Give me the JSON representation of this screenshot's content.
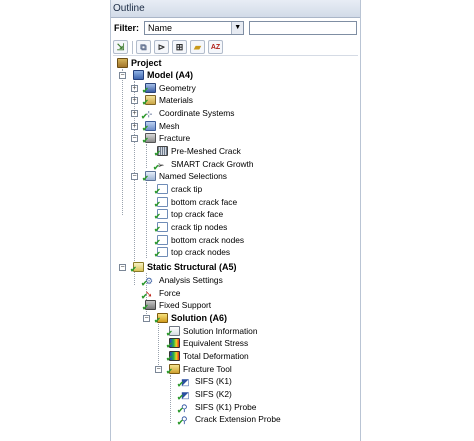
{
  "panel": {
    "title": "Outline"
  },
  "filter": {
    "label": "Filter:",
    "value": "Name",
    "search_value": ""
  },
  "toolbar": {
    "buttons": [
      {
        "icon": "expand-tree-icon"
      },
      {
        "icon": "collapse-tree-icon"
      },
      {
        "icon": "flow-icon"
      },
      {
        "icon": "add-icon"
      },
      {
        "icon": "folder-icon"
      },
      {
        "icon": "sort-az-icon",
        "glyph": "AZ"
      }
    ]
  },
  "tree": {
    "project": "Project",
    "model": "Model (A4)",
    "geometry": "Geometry",
    "materials": "Materials",
    "coordinate_systems": "Coordinate Systems",
    "mesh": "Mesh",
    "fracture": "Fracture",
    "pre_meshed_crack": "Pre-Meshed Crack",
    "smart_crack_growth": "SMART Crack Growth",
    "named_selections": "Named Selections",
    "crack_tip": "crack tip",
    "bottom_crack_face": "bottom crack face",
    "top_crack_face": "top crack face",
    "crack_tip_nodes": "crack tip nodes",
    "bottom_crack_nodes": "bottom crack nodes",
    "top_crack_nodes": "top crack nodes",
    "static_structural": "Static Structural (A5)",
    "analysis_settings": "Analysis Settings",
    "force": "Force",
    "fixed_support": "Fixed Support",
    "solution": "Solution (A6)",
    "solution_information": "Solution Information",
    "equivalent_stress": "Equivalent Stress",
    "total_deformation": "Total Deformation",
    "fracture_tool": "Fracture Tool",
    "sifs_k1": "SIFS (K1)",
    "sifs_k2": "SIFS (K2)",
    "sifs_k1_probe": "SIFS (K1) Probe",
    "crack_extension_probe": "Crack Extension Probe"
  },
  "colors": {
    "check": "#2e9a2e",
    "title_text": "#1b2b44"
  }
}
